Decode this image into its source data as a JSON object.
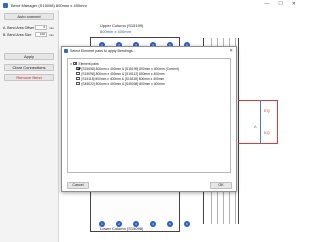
{
  "window": {
    "title": "Bend Manager (S15098) 800mm x 400mm",
    "controls": {
      "minimize": "—",
      "maximize": "☐",
      "close": "✕"
    }
  },
  "left_panel": {
    "auto_connect_label": "Auto connect",
    "bend_area_offset": {
      "label": "A. Bend Area Offset",
      "value": "0",
      "unit": "mm"
    },
    "bend_area_size": {
      "label": "B. Bend Area Size",
      "value": "100",
      "unit": "mm"
    },
    "apply_label": "Apply",
    "clear_connections_label": "Clear Connections",
    "remove_bend_label": "Remove Bend"
  },
  "drawing": {
    "upper_column_title": "Upper Column (S15199)",
    "upper_column_size": "800mm x 400mm",
    "lower_column_title": "Lower Column (S15098)",
    "top_rebar_labels": [
      "1",
      "2",
      "3",
      "4",
      "5",
      "6"
    ],
    "bottom_rebar_labels": [
      "1",
      "2",
      "3",
      "4",
      "5",
      "6"
    ],
    "dim_labels": [
      "EQ",
      "EQ"
    ],
    "dim_a_label": "A",
    "accent_color": "#2a5dd6",
    "highlight_color": "#e53935"
  },
  "dialog": {
    "title": "Select Element pairs to apply Bendings...",
    "root_label": "Element pairs",
    "items": [
      {
        "label": "[S15098] 800mm x 400mm & [S15199] 800mm x 400mm (Current)",
        "checked": true
      },
      {
        "label": "[S15098] 800mm x 400mm & [S15112] 800mm x 400mm",
        "checked": false
      },
      {
        "label": "[S15118] 800mm x 400mm & [S15118] 800mm x 400mm",
        "checked": false
      },
      {
        "label": "[S45022] 800mm x 400mm & [S45008] 800mm x 400mm",
        "checked": false
      }
    ],
    "cancel_label": "Cancel",
    "ok_label": "OK"
  }
}
